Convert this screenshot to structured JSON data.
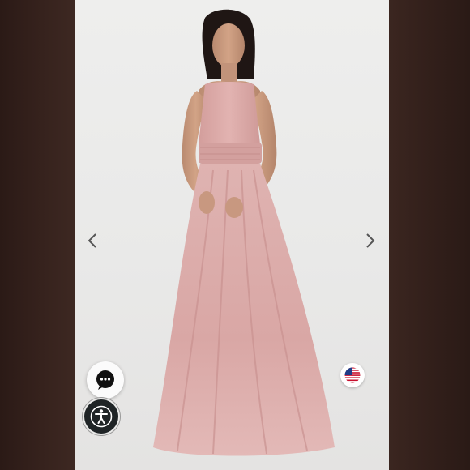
{
  "product_image": {
    "subject": "model-in-blush-halter-tulle-gown",
    "background_color": "#e9e9e8",
    "dress_color": "#dcaaa9"
  },
  "gallery_nav": {
    "prev_icon": "chevron-left-icon",
    "next_icon": "chevron-right-icon"
  },
  "widgets": {
    "chat_icon": "chat-bubble-icon",
    "accessibility_icon": "accessibility-icon",
    "region_icon": "us-flag-icon"
  },
  "colors": {
    "side_panel": "#2f1e19",
    "accessibility_button": "#1f2426",
    "chat_button": "#fbfbfb"
  }
}
